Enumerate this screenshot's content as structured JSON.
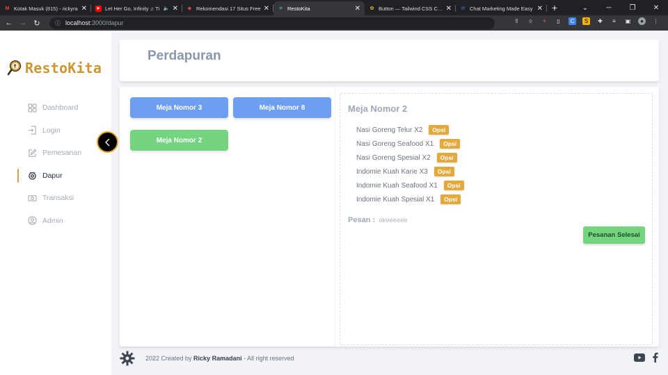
{
  "browser": {
    "tabs": [
      {
        "title": "Kotak Masuk (815) - rickyra",
        "fav": "M",
        "fav_color": "#ea4335"
      },
      {
        "title": "Let Her Go, Infinity ♫ Ti",
        "fav": "▶",
        "fav_color": "#ff0000",
        "audio": "🔈"
      },
      {
        "title": "Rekomendasi 17 Situs Free",
        "fav": "◆",
        "fav_color": "#e04b4b"
      },
      {
        "title": "RestoKita",
        "fav": "⚛",
        "fav_color": "#61dafb",
        "active": true
      },
      {
        "title": "Button — Tailwind CSS Com",
        "fav": "✿",
        "fav_color": "#f5c518"
      },
      {
        "title": "Chat Marketing Made Easy",
        "fav": "✉",
        "fav_color": "#4c7bd9"
      }
    ],
    "url_host": "localhost",
    "url_path": ":3000/dapur"
  },
  "sidebar": {
    "brand": "RestoKita",
    "menu": [
      {
        "label": "Dashboard",
        "icon": "grid-icon"
      },
      {
        "label": "Login",
        "icon": "login-icon"
      },
      {
        "label": "Pemesanan",
        "icon": "edit-icon"
      },
      {
        "label": "Dapur",
        "icon": "dapur-icon",
        "active": true
      },
      {
        "label": "Transaksi",
        "icon": "money-icon"
      },
      {
        "label": "Admin",
        "icon": "user-icon"
      }
    ]
  },
  "page": {
    "title": "Perdapuran",
    "tables": [
      {
        "label": "Meja Nomor 3",
        "color": "#6e9ef0"
      },
      {
        "label": "Meja Nomor 8",
        "color": "#6e9ef0"
      },
      {
        "label": "Meja Nomor 2",
        "color": "#74d480"
      }
    ],
    "detail": {
      "title": "Meja Nomor 2",
      "orders": [
        {
          "item": "Nasi Goreng Telur X2",
          "action": "Opsi"
        },
        {
          "item": "Nasi Goreng Seafood X1",
          "action": "Opsi"
        },
        {
          "item": "Nasi Goreng Spesial X2",
          "action": "Opsi"
        },
        {
          "item": "Indomie Kuah Karie X3",
          "action": "Opsi"
        },
        {
          "item": "Indomie Kuah Seafood X1",
          "action": "Opsi"
        },
        {
          "item": "Indomie Kuah Spesial X1",
          "action": "Opsi"
        }
      ],
      "message_label": "Pesan :",
      "message_value": "okeeeeee",
      "done_button": "Pesanan Selesai"
    }
  },
  "footer": {
    "prefix": "2022 Created by ",
    "author": "Ricky Ramadani",
    "suffix": " - All right reserved"
  },
  "colors": {
    "accent": "#c9962f",
    "blue_button": "#6e9ef0",
    "green_button": "#74d480",
    "opsi_badge": "#e3a93c"
  }
}
